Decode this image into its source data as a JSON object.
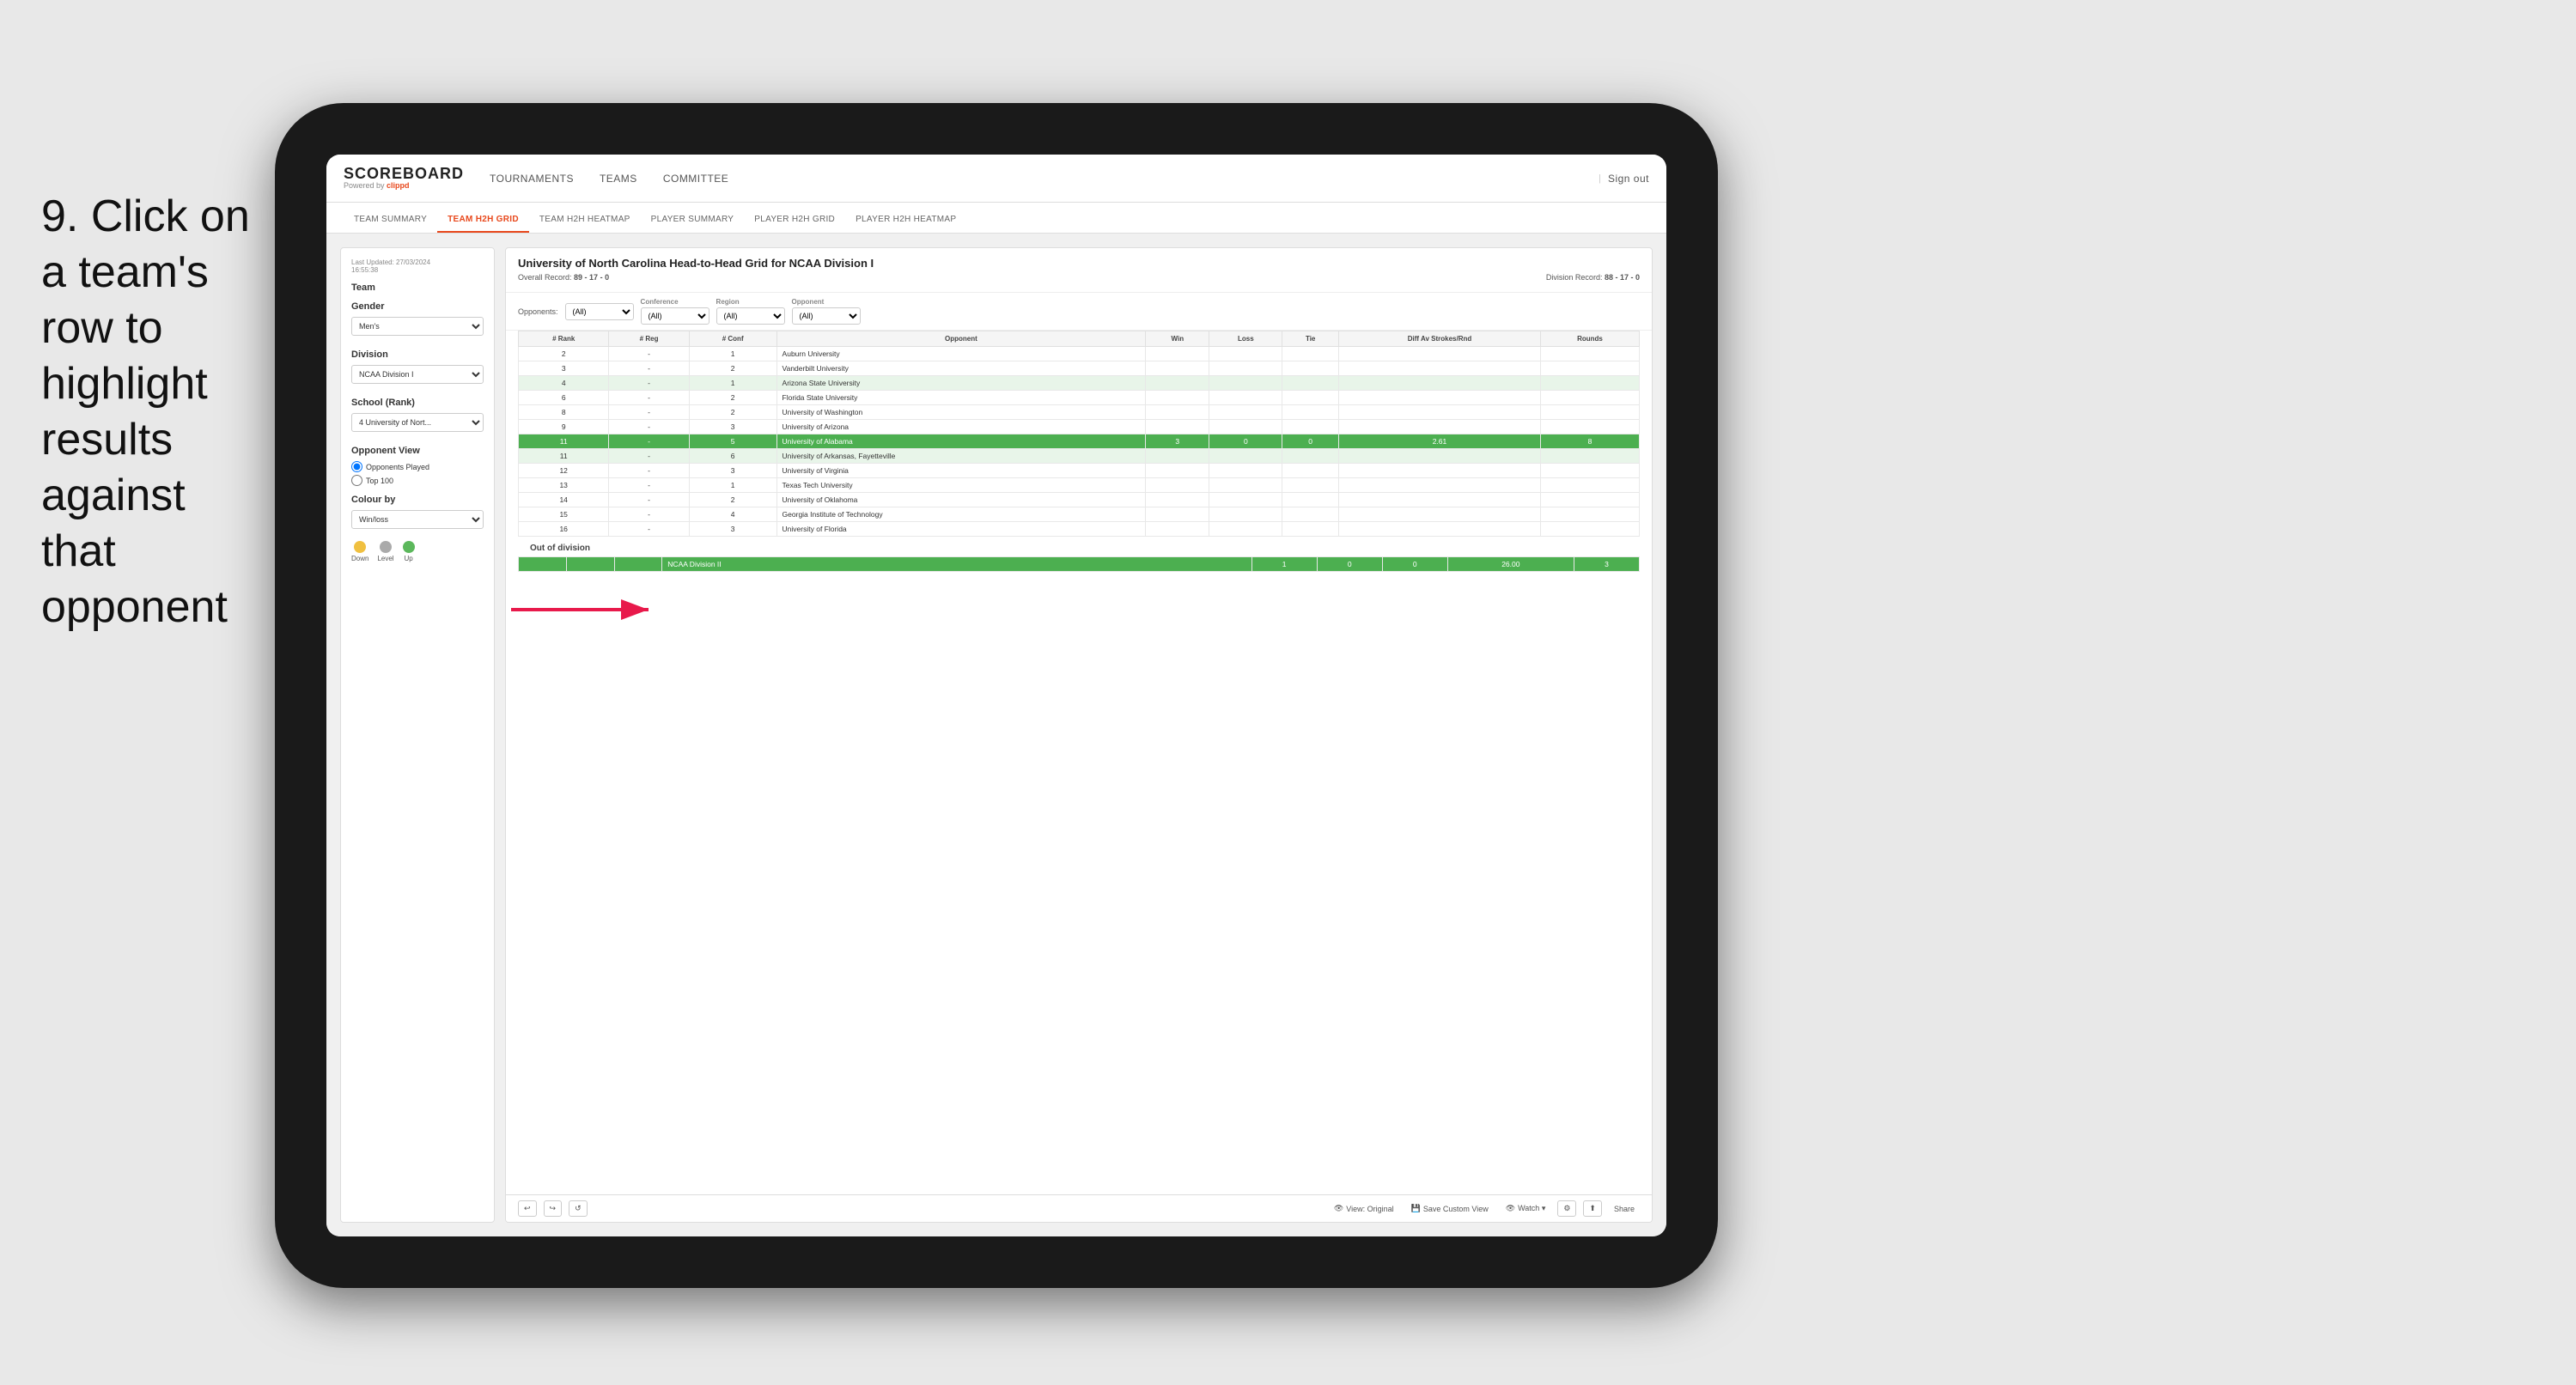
{
  "instruction": {
    "step": "9.",
    "text": "Click on a team's row to highlight results against that opponent"
  },
  "nav": {
    "logo": "SCOREBOARD",
    "powered_by": "Powered by",
    "brand": "clippd",
    "items": [
      "TOURNAMENTS",
      "TEAMS",
      "COMMITTEE"
    ],
    "sign_out": "Sign out"
  },
  "sub_nav": {
    "items": [
      "TEAM SUMMARY",
      "TEAM H2H GRID",
      "TEAM H2H HEATMAP",
      "PLAYER SUMMARY",
      "PLAYER H2H GRID",
      "PLAYER H2H HEATMAP"
    ],
    "active": "TEAM H2H GRID"
  },
  "sidebar": {
    "last_updated_label": "Last Updated: 27/03/2024",
    "last_updated_time": "16:55:38",
    "team_label": "Team",
    "gender_label": "Gender",
    "gender_value": "Men's",
    "division_label": "Division",
    "division_value": "NCAA Division I",
    "school_label": "School (Rank)",
    "school_value": "4 University of Nort...",
    "opponent_view_label": "Opponent View",
    "opponents_played_label": "Opponents Played",
    "top100_label": "Top 100",
    "colour_by_label": "Colour by",
    "colour_by_value": "Win/loss",
    "legend": {
      "down_label": "Down",
      "level_label": "Level",
      "up_label": "Up"
    }
  },
  "grid": {
    "title": "University of North Carolina Head-to-Head Grid for NCAA Division I",
    "overall_record_label": "Overall Record:",
    "overall_record_value": "89 - 17 - 0",
    "division_record_label": "Division Record:",
    "division_record_value": "88 - 17 - 0",
    "filters": {
      "opponents_label": "Opponents:",
      "opponents_value": "(All)",
      "conference_label": "Conference",
      "conference_value": "(All)",
      "region_label": "Region",
      "region_value": "(All)",
      "opponent_label": "Opponent",
      "opponent_value": "(All)"
    },
    "columns": [
      "# Rank",
      "# Reg",
      "# Conf",
      "Opponent",
      "Win",
      "Loss",
      "Tie",
      "Diff Av Strokes/Rnd",
      "Rounds"
    ],
    "rows": [
      {
        "rank": "2",
        "reg": "-",
        "conf": "1",
        "opponent": "Auburn University",
        "win": "",
        "loss": "",
        "tie": "",
        "diff": "",
        "rounds": "",
        "style": "normal"
      },
      {
        "rank": "3",
        "reg": "-",
        "conf": "2",
        "opponent": "Vanderbilt University",
        "win": "",
        "loss": "",
        "tie": "",
        "diff": "",
        "rounds": "",
        "style": "normal"
      },
      {
        "rank": "4",
        "reg": "-",
        "conf": "1",
        "opponent": "Arizona State University",
        "win": "",
        "loss": "",
        "tie": "",
        "diff": "",
        "rounds": "",
        "style": "light-green"
      },
      {
        "rank": "6",
        "reg": "-",
        "conf": "2",
        "opponent": "Florida State University",
        "win": "",
        "loss": "",
        "tie": "",
        "diff": "",
        "rounds": "",
        "style": "normal"
      },
      {
        "rank": "8",
        "reg": "-",
        "conf": "2",
        "opponent": "University of Washington",
        "win": "",
        "loss": "",
        "tie": "",
        "diff": "",
        "rounds": "",
        "style": "normal"
      },
      {
        "rank": "9",
        "reg": "-",
        "conf": "3",
        "opponent": "University of Arizona",
        "win": "",
        "loss": "",
        "tie": "",
        "diff": "",
        "rounds": "",
        "style": "normal"
      },
      {
        "rank": "11",
        "reg": "-",
        "conf": "5",
        "opponent": "University of Alabama",
        "win": "3",
        "loss": "0",
        "tie": "0",
        "diff": "2.61",
        "rounds": "8",
        "style": "highlighted"
      },
      {
        "rank": "11",
        "reg": "-",
        "conf": "6",
        "opponent": "University of Arkansas, Fayetteville",
        "win": "",
        "loss": "",
        "tie": "",
        "diff": "",
        "rounds": "",
        "style": "light-green"
      },
      {
        "rank": "12",
        "reg": "-",
        "conf": "3",
        "opponent": "University of Virginia",
        "win": "",
        "loss": "",
        "tie": "",
        "diff": "",
        "rounds": "",
        "style": "normal"
      },
      {
        "rank": "13",
        "reg": "-",
        "conf": "1",
        "opponent": "Texas Tech University",
        "win": "",
        "loss": "",
        "tie": "",
        "diff": "",
        "rounds": "",
        "style": "normal"
      },
      {
        "rank": "14",
        "reg": "-",
        "conf": "2",
        "opponent": "University of Oklahoma",
        "win": "",
        "loss": "",
        "tie": "",
        "diff": "",
        "rounds": "",
        "style": "normal"
      },
      {
        "rank": "15",
        "reg": "-",
        "conf": "4",
        "opponent": "Georgia Institute of Technology",
        "win": "",
        "loss": "",
        "tie": "",
        "diff": "",
        "rounds": "",
        "style": "normal"
      },
      {
        "rank": "16",
        "reg": "-",
        "conf": "3",
        "opponent": "University of Florida",
        "win": "",
        "loss": "",
        "tie": "",
        "diff": "",
        "rounds": "",
        "style": "normal"
      }
    ],
    "out_of_division_label": "Out of division",
    "out_of_division_row": {
      "name": "NCAA Division II",
      "win": "1",
      "loss": "0",
      "tie": "0",
      "diff": "26.00",
      "rounds": "3"
    }
  },
  "toolbar": {
    "undo": "↩",
    "redo": "↪",
    "reset": "↺",
    "view_original": "View: Original",
    "save_custom_view": "Save Custom View",
    "watch": "Watch ▾",
    "share": "Share"
  }
}
